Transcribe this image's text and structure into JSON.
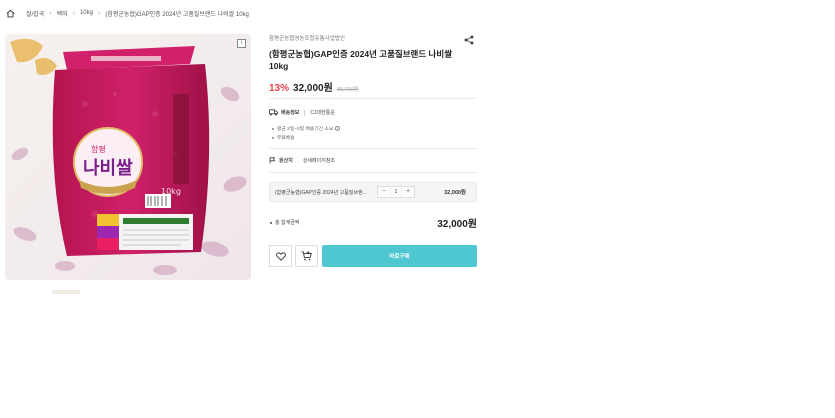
{
  "breadcrumb": {
    "items": [
      "쌀/잡곡",
      "백미",
      "10kg",
      "(함평군농협)GAP인증 2024년 고품질브랜드 나비쌀 10kg"
    ]
  },
  "product": {
    "ad_badge": "i",
    "seller": "함평군농협영농조합유통사업법인",
    "title": "(함평군농협)GAP인증 2024년 고품질브랜드 나비쌀 10kg",
    "discount": "13%",
    "price": "32,000원",
    "original_price": "36,700원",
    "package_text": {
      "brand_small": "함평",
      "brand_big": "나비쌀",
      "weight": "10kg"
    }
  },
  "shipping": {
    "label": "배송정보",
    "carrier": "CJ대한통운",
    "notes": [
      "평균 2일~3일 배송기간 소요",
      "무료배송"
    ],
    "info_icon": "i"
  },
  "origin": {
    "label": "원산지",
    "value": "상세페이지참조"
  },
  "option": {
    "name": "(함평군농협)GAP인증 2024년 고품질브랜...",
    "minus": "−",
    "quantity": "1",
    "plus": "+",
    "price": "32,000원"
  },
  "total": {
    "label": "총 합계금액",
    "price": "32,000원"
  },
  "actions": {
    "buy_label": "바로구매"
  },
  "colors": {
    "accent": "#4fc7d1",
    "discount": "#e8434e",
    "package": "#c2185b"
  }
}
